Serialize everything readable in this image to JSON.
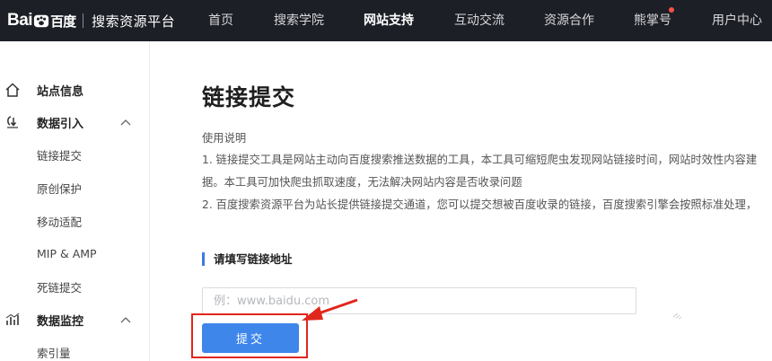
{
  "header": {
    "logo_text": "Bai",
    "logo_suffix": "百度",
    "platform_name": "搜索资源平台",
    "nav": [
      {
        "label": "首页",
        "active": false,
        "dot": false
      },
      {
        "label": "搜索学院",
        "active": false,
        "dot": false
      },
      {
        "label": "网站支持",
        "active": true,
        "dot": false
      },
      {
        "label": "互动交流",
        "active": false,
        "dot": false
      },
      {
        "label": "资源合作",
        "active": false,
        "dot": false
      },
      {
        "label": "熊掌号",
        "active": false,
        "dot": true
      },
      {
        "label": "用户中心",
        "active": false,
        "dot": false
      }
    ]
  },
  "sidebar": {
    "site_info": {
      "label": "站点信息",
      "icon": "home-icon"
    },
    "data_import": {
      "label": "数据引入",
      "icon": "data-import-icon",
      "expanded": true
    },
    "import_items": [
      "链接提交",
      "原创保护",
      "移动适配",
      "MIP & AMP",
      "死链提交"
    ],
    "data_monitor": {
      "label": "数据监控",
      "icon": "bar-chart-icon",
      "expanded": true
    },
    "monitor_items": [
      "索引量"
    ]
  },
  "main": {
    "title": "链接提交",
    "usage_heading": "使用说明",
    "usage_lines": [
      "1. 链接提交工具是网站主动向百度搜索推送数据的工具，本工具可缩短爬虫发现网站链接时间，网站时效性内容建",
      "据。本工具可加快爬虫抓取速度，无法解决网站内容是否收录问题",
      "2. 百度搜索资源平台为站长提供链接提交通道，您可以提交想被百度收录的链接，百度搜索引擎会按照标准处理，"
    ],
    "field_label": "请填写链接地址",
    "url_input": {
      "value": "",
      "placeholder": "例：www.baidu.com"
    },
    "submit_label": "提交"
  },
  "colors": {
    "topbar_bg": "#1d1f26",
    "accent_blue": "#3e86ea",
    "annotation_red": "#e1261c",
    "notification_dot": "#f5504a"
  }
}
